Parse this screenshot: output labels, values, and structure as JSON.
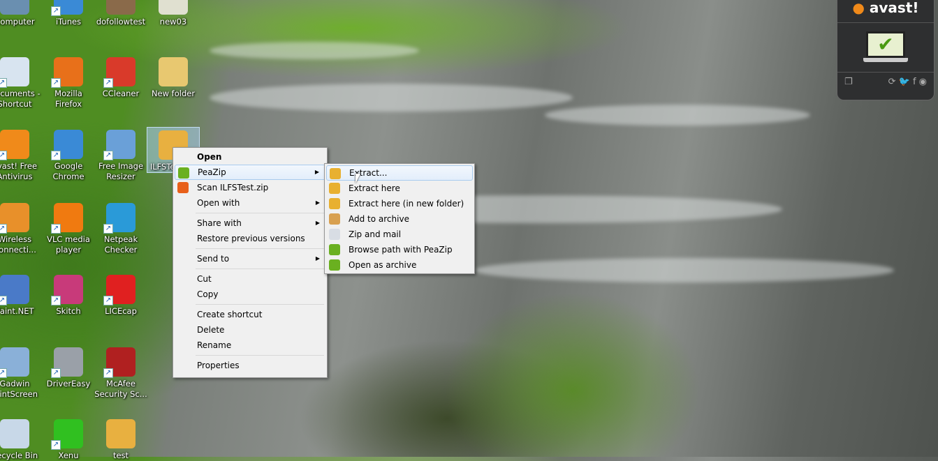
{
  "desktop": {
    "rows": [
      [
        {
          "label": "Computer",
          "color": "#6a8fb0"
        },
        {
          "label": "iTunes",
          "color": "#3a8ad6",
          "sc": true
        },
        {
          "label": "dofollowtest",
          "color": "#8a6a4a"
        },
        {
          "label": "new03",
          "color": "#e0e0d0"
        }
      ],
      [
        {
          "label": "Documents - Shortcut",
          "color": "#d8e4f0",
          "sc": true
        },
        {
          "label": "Mozilla Firefox",
          "color": "#e8701a",
          "sc": true
        },
        {
          "label": "CCleaner",
          "color": "#d93a2a",
          "sc": true
        },
        {
          "label": "New folder",
          "color": "#e8c870"
        }
      ],
      [
        {
          "label": "avast! Free Antivirus",
          "color": "#f08a1a",
          "sc": true
        },
        {
          "label": "Google Chrome",
          "color": "#3a8ad6",
          "sc": true
        },
        {
          "label": "Free Image Resizer",
          "color": "#6aa0d8",
          "sc": true
        },
        {
          "label": "ILFSTest.zip",
          "color": "#e8b040",
          "selected": true
        }
      ],
      [
        {
          "label": "Wireless Connecti...",
          "color": "#e8902a",
          "sc": true
        },
        {
          "label": "VLC media player",
          "color": "#f07a10",
          "sc": true
        },
        {
          "label": "Netpeak Checker",
          "color": "#2a9ad8",
          "sc": true
        }
      ],
      [
        {
          "label": "Paint.NET",
          "color": "#4a7ac8",
          "sc": true
        },
        {
          "label": "Skitch",
          "color": "#c83a7a",
          "sc": true
        },
        {
          "label": "LICEcap",
          "color": "#e02020",
          "sc": true
        }
      ],
      [
        {
          "label": "Gadwin PrintScreen",
          "color": "#8ab0d8",
          "sc": true
        },
        {
          "label": "DriverEasy",
          "color": "#9aa0a8",
          "sc": true
        },
        {
          "label": "McAfee Security Sc...",
          "color": "#b02020",
          "sc": true
        }
      ],
      [
        {
          "label": "Recycle Bin",
          "color": "#c8d8e8"
        },
        {
          "label": "Xenu",
          "color": "#30c020",
          "sc": true
        },
        {
          "label": "test",
          "color": "#e8b040"
        }
      ]
    ]
  },
  "context_menu": {
    "items": [
      {
        "label": "Open",
        "bold": true
      },
      {
        "label": "PeaZip",
        "icon": "peazip-icon",
        "color": "#6ab020",
        "submenu": true,
        "highlighted": true
      },
      {
        "label": "Scan ILFSTest.zip",
        "icon": "avast-scan-icon",
        "color": "#e8601a"
      },
      {
        "label": "Open with",
        "submenu": true
      },
      {
        "sep": true
      },
      {
        "label": "Share with",
        "submenu": true
      },
      {
        "label": "Restore previous versions"
      },
      {
        "sep": true
      },
      {
        "label": "Send to",
        "submenu": true
      },
      {
        "sep": true
      },
      {
        "label": "Cut"
      },
      {
        "label": "Copy"
      },
      {
        "sep": true
      },
      {
        "label": "Create shortcut"
      },
      {
        "label": "Delete"
      },
      {
        "label": "Rename"
      },
      {
        "sep": true
      },
      {
        "label": "Properties"
      }
    ]
  },
  "peazip_submenu": {
    "items": [
      {
        "label": "Extract...",
        "icon": "extract-icon",
        "color": "#e8b030",
        "highlighted": true
      },
      {
        "label": "Extract here",
        "icon": "extract-icon",
        "color": "#e8b030"
      },
      {
        "label": "Extract here (in new folder)",
        "icon": "extract-icon",
        "color": "#e8b030"
      },
      {
        "label": "Add to archive",
        "icon": "add-archive-icon",
        "color": "#d8a050"
      },
      {
        "label": "Zip and mail",
        "icon": "mail-icon",
        "color": "#d8dde4"
      },
      {
        "label": "Browse path with PeaZip",
        "icon": "peazip-icon",
        "color": "#6ab020"
      },
      {
        "label": "Open as archive",
        "icon": "peazip-icon",
        "color": "#6ab020"
      }
    ]
  },
  "avast_widget": {
    "brand": "avast!",
    "status_icon": "laptop-check-icon",
    "accent": "#f08a1a"
  }
}
